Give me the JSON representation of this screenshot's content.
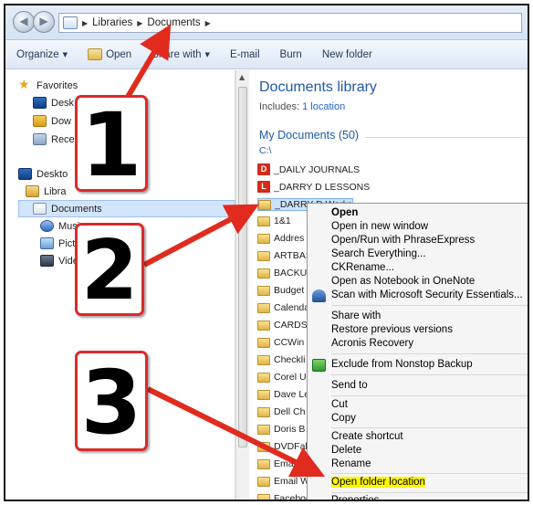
{
  "breadcrumb": [
    "Libraries",
    "Documents"
  ],
  "toolbar": {
    "organize": "Organize",
    "open": "Open",
    "share_with": "Share with",
    "email": "E-mail",
    "burn": "Burn",
    "new_folder": "New folder"
  },
  "nav": {
    "favorites": "Favorites",
    "desktop": "Desk",
    "downloads": "Dow",
    "recent": "Rece",
    "desktop2": "Deskto",
    "libraries": "Libra",
    "documents": "Documents",
    "music": "Music",
    "pictures": "Pictu",
    "videos": "Vide"
  },
  "content": {
    "title": "Documents library",
    "includes_label": "Includes:",
    "includes_link": "1 location",
    "group_header": "My Documents (50)",
    "path": "C:\\",
    "items": [
      {
        "name": "_DAILY JOURNALS",
        "icon": "red-d"
      },
      {
        "name": "_DARRY D LESSONS",
        "icon": "red-l"
      },
      {
        "name": "_DARRY D Works",
        "icon": "folder",
        "selected": true
      },
      {
        "name": "1&1",
        "icon": "folder"
      },
      {
        "name": "Addres",
        "icon": "folder"
      },
      {
        "name": "ARTBAS",
        "icon": "folder"
      },
      {
        "name": "BACKUI",
        "icon": "folder"
      },
      {
        "name": "Budget",
        "icon": "folder"
      },
      {
        "name": "Calenda",
        "icon": "folder"
      },
      {
        "name": "CARDS",
        "icon": "folder"
      },
      {
        "name": "CCWin",
        "icon": "folder"
      },
      {
        "name": "Checkli",
        "icon": "folder"
      },
      {
        "name": "Corel U",
        "icon": "folder"
      },
      {
        "name": "Dave Le",
        "icon": "folder"
      },
      {
        "name": "Dell Ch",
        "icon": "folder"
      },
      {
        "name": "Doris B",
        "icon": "folder"
      },
      {
        "name": "DVDFal",
        "icon": "folder"
      },
      {
        "name": "Emai",
        "icon": "folder"
      },
      {
        "name": "Email W",
        "icon": "folder"
      },
      {
        "name": "Faceboo",
        "icon": "folder"
      }
    ]
  },
  "menu": {
    "open": "Open",
    "open_new_window": "Open in new window",
    "open_run_phrase": "Open/Run with PhraseExpress",
    "search_everything": "Search Everything...",
    "ckrename": "CKRename...",
    "onenote": "Open as Notebook in OneNote",
    "mse_scan": "Scan with Microsoft Security Essentials...",
    "share_with": "Share with",
    "restore": "Restore previous versions",
    "acronis": "Acronis Recovery",
    "exclude": "Exclude from Nonstop Backup",
    "send_to": "Send to",
    "cut": "Cut",
    "copy": "Copy",
    "create_shortcut": "Create shortcut",
    "delete": "Delete",
    "rename": "Rename",
    "open_folder_location": "Open folder location",
    "properties": "Properties"
  },
  "callouts": [
    "1",
    "2",
    "3"
  ],
  "colors": {
    "arrow": "#e02b1e",
    "highlight": "#fff900",
    "title_blue": "#1e5aa8"
  }
}
